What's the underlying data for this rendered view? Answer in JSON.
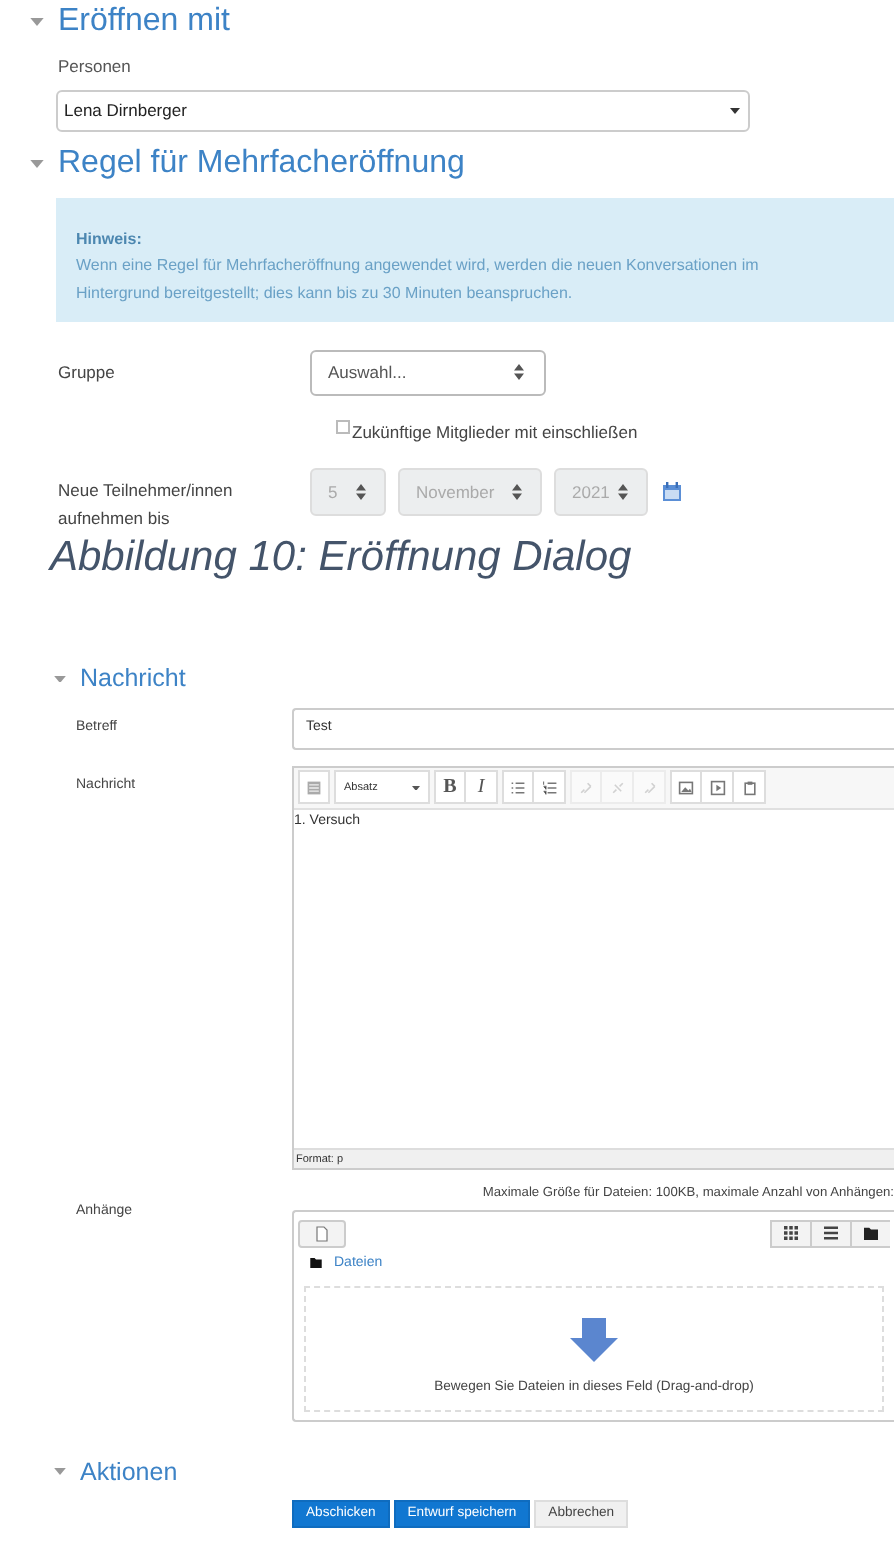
{
  "top_form": {
    "open_with": {
      "title": "Eröffnen mit",
      "field_label": "Personen",
      "value": "Lena Dirnberger"
    },
    "rule": {
      "title": "Regel für Mehrfacheröffnung",
      "notice_title": "Hinweis:",
      "notice_text": "Wenn eine Regel für Mehrfacheröffnung angewendet wird, werden die neuen Konversationen im Hintergrund bereitgestellt; dies kann bis zu 30 Minuten beanspruchen.",
      "group_label": "Gruppe",
      "group_value": "Auswahl...",
      "checkbox": {
        "label": "Zukünftige Mitglieder mit einschließen",
        "checked": false
      },
      "date_label": "Neue Teilnehmer/innen aufnehmen bis",
      "date": {
        "disabled": true,
        "parts": [
          "5",
          "November",
          "2021"
        ]
      }
    }
  },
  "caption": "Abbildung 10: Eröffnung Dialog",
  "bottom_form": {
    "message": {
      "title": "Nachricht",
      "subject_label": "Betreff",
      "subject": "Test",
      "message_label": "Nachricht",
      "format_select": "Absatz",
      "toolbar": [
        [
          {
            "kind": "toggle",
            "disabled": false
          }
        ],
        [
          {
            "kind": "bold",
            "label": "B",
            "disabled": false
          },
          {
            "kind": "italic",
            "label": "I",
            "disabled": false
          }
        ],
        [
          {
            "kind": "bullets",
            "disabled": false
          },
          {
            "kind": "numbers",
            "disabled": false
          }
        ],
        [
          {
            "kind": "link",
            "disabled": true
          },
          {
            "kind": "unlink",
            "disabled": true
          },
          {
            "kind": "link",
            "disabled": true
          }
        ],
        [
          {
            "kind": "image",
            "disabled": false
          },
          {
            "kind": "media",
            "disabled": false
          },
          {
            "kind": "paste",
            "disabled": false
          }
        ]
      ],
      "body": "1. Versuch",
      "status": "Format: p"
    },
    "attachments": {
      "label": "Anhänge",
      "limits": "Maximale Größe für Dateien: 100KB, maximale Anzahl von Anhängen:",
      "path": "Dateien",
      "drop_hint": "Bewegen Sie Dateien in dieses Feld (Drag-and-drop)"
    },
    "actions": {
      "title": "Aktionen",
      "buttons": [
        {
          "label": "Abschicken",
          "primary": true
        },
        {
          "label": "Entwurf speichern",
          "primary": true
        },
        {
          "label": "Abbrechen",
          "primary": false
        }
      ]
    }
  }
}
